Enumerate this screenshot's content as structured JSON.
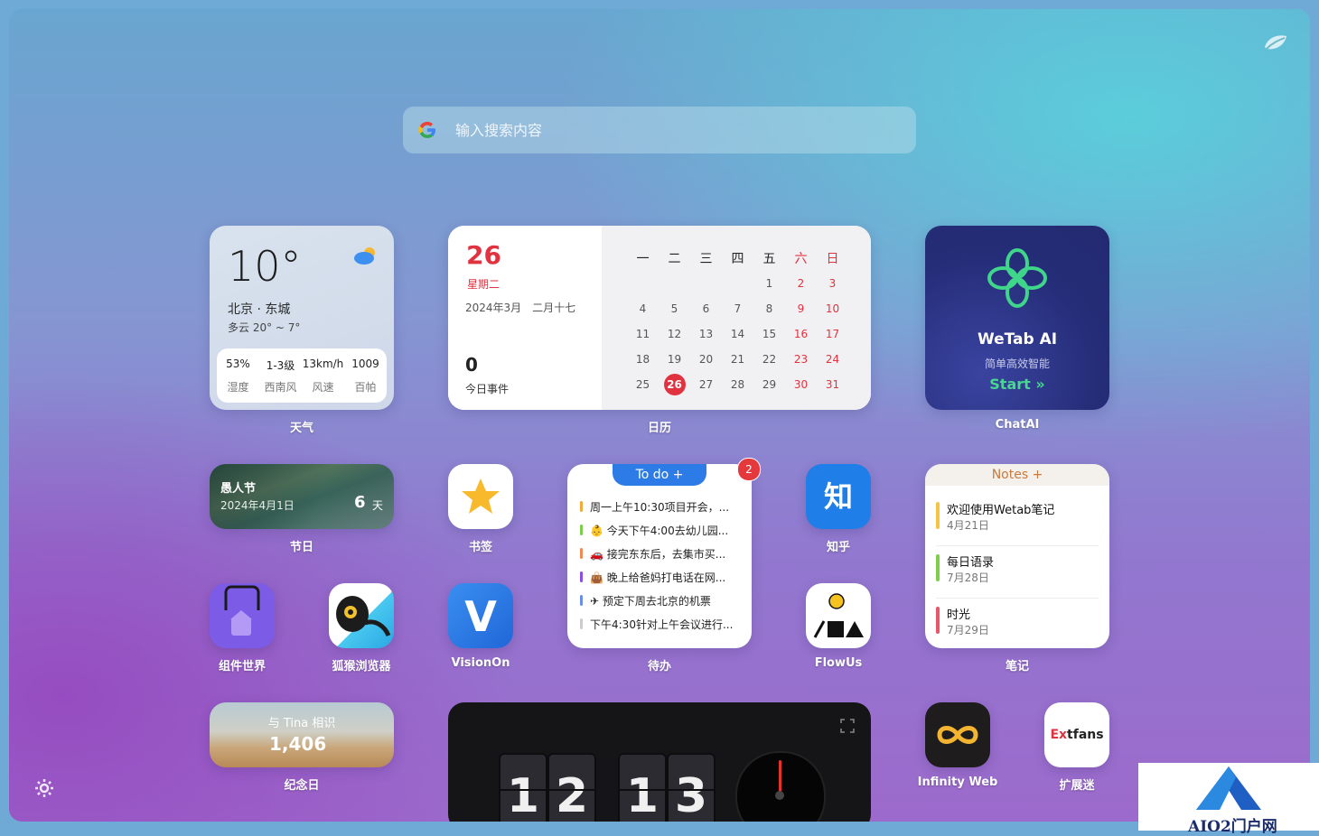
{
  "search": {
    "placeholder": "输入搜索内容",
    "engine_icon": "google-g-icon"
  },
  "weather": {
    "temp": "10°",
    "city": "北京 · 东城",
    "desc": "多云 20° ~ 7°",
    "stats": [
      {
        "value": "53%",
        "key": "湿度"
      },
      {
        "value": "1-3级",
        "key": "西南风"
      },
      {
        "value": "13km/h",
        "key": "风速"
      },
      {
        "value": "1009",
        "key": "百帕"
      }
    ],
    "label": "天气"
  },
  "calendar": {
    "day": "26",
    "weekday": "星期二",
    "date": "2024年3月　二月十七",
    "event_count": "0",
    "event_label": "今日事件",
    "weekdays": [
      "一",
      "二",
      "三",
      "四",
      "五",
      "六",
      "日"
    ],
    "rows": [
      [
        "",
        "",
        "",
        "",
        "1",
        "2",
        "3"
      ],
      [
        "4",
        "5",
        "6",
        "7",
        "8",
        "9",
        "10"
      ],
      [
        "11",
        "12",
        "13",
        "14",
        "15",
        "16",
        "17"
      ],
      [
        "18",
        "19",
        "20",
        "21",
        "22",
        "23",
        "24"
      ],
      [
        "25",
        "26",
        "27",
        "28",
        "29",
        "30",
        "31"
      ]
    ],
    "today": "26",
    "label": "日历"
  },
  "chatai": {
    "title": "WeTab AI",
    "subtitle": "简单高效智能",
    "start": "Start »",
    "label": "ChatAI"
  },
  "holiday": {
    "name": "愚人节",
    "date": "2024年4月1日",
    "days": "6",
    "unit": "天",
    "label": "节日"
  },
  "apps": {
    "bookmark": "书签",
    "zhihu": "知乎",
    "zhihu_glyph": "知",
    "widget_world": "组件世界",
    "browser": "狐猴浏览器",
    "visionon": "VisionOn",
    "visionon_glyph": "V",
    "flowus": "FlowUs",
    "infinity": "Infinity Web",
    "extfans": "扩展迷",
    "extfans_logo_a": "Ex",
    "extfans_logo_b": "tfans"
  },
  "todo": {
    "title": "To do +",
    "badge": "2",
    "label": "待办",
    "items": [
      {
        "text": "周一上午10:30项目开会，...",
        "color": "#f2a93b"
      },
      {
        "text": "👶 今天下午4:00去幼儿园...",
        "color": "#7ccf4a"
      },
      {
        "text": "🚗 接完东东后，去集市买...",
        "color": "#ef8a52"
      },
      {
        "text": "👜 晚上给爸妈打电话在网...",
        "color": "#8a4ee0"
      },
      {
        "text": "✈ 预定下周去北京的机票",
        "color": "#6b8de8"
      },
      {
        "text": "下午4:30针对上午会议进行...",
        "color": "#cccccc"
      }
    ]
  },
  "notes": {
    "title": "Notes +",
    "label": "笔记",
    "items": [
      {
        "title": "欢迎使用Wetab笔记",
        "date": "4月21日",
        "color": "#f5c542"
      },
      {
        "title": "每日语录",
        "date": "7月28日",
        "color": "#7ccf4a"
      },
      {
        "title": "时光",
        "date": "7月29日",
        "color": "#e8566a"
      }
    ]
  },
  "anniversary": {
    "title": "与 Tina 相识",
    "count": "1,406",
    "label": "纪念日"
  },
  "clock": {
    "digits": [
      "1",
      "2",
      "1",
      "3"
    ]
  },
  "watermark": {
    "text": "AIO2门户网"
  }
}
